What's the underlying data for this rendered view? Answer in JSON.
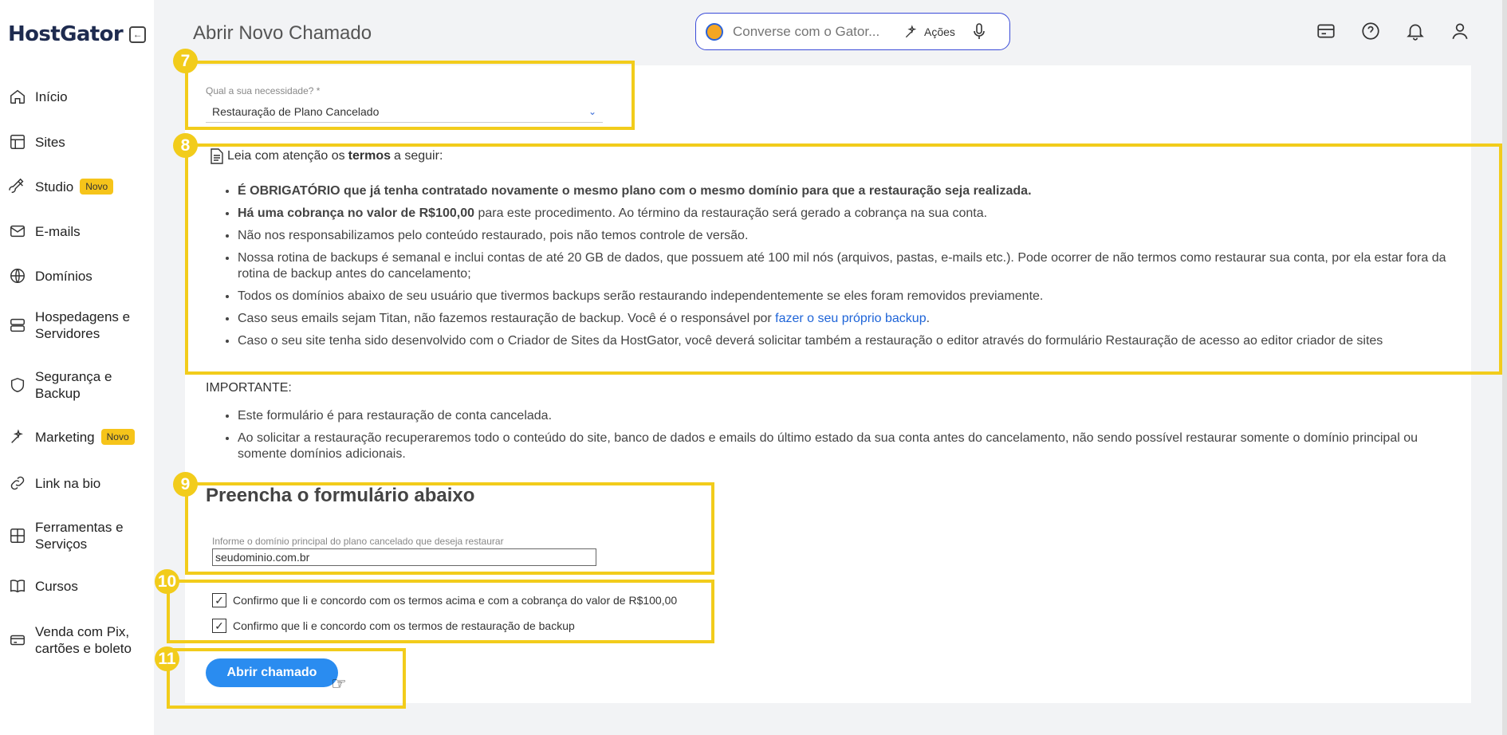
{
  "brand": {
    "logo": "HostGator",
    "collapse_icon": "arrow-left-box-icon"
  },
  "sidebar": {
    "items": [
      {
        "label": "Início",
        "icon": "home-icon"
      },
      {
        "label": "Sites",
        "icon": "layout-icon"
      },
      {
        "label": "Studio",
        "icon": "brush-icon",
        "badge": "Novo"
      },
      {
        "label": "E-mails",
        "icon": "mail-icon"
      },
      {
        "label": "Domínios",
        "icon": "globe-icon"
      },
      {
        "label": "Hospedagens e\nServidores",
        "icon": "server-icon"
      },
      {
        "label": "Segurança e\nBackup",
        "icon": "shield-icon"
      },
      {
        "label": "Marketing",
        "icon": "sparkle-icon",
        "badge": "Novo"
      },
      {
        "label": "Link na bio",
        "icon": "link-icon"
      },
      {
        "label": "Ferramentas e\nServiços",
        "icon": "tools-icon"
      },
      {
        "label": "Cursos",
        "icon": "book-icon"
      },
      {
        "label": "Venda com Pix,\ncartões e boleto",
        "icon": "payment-icon"
      }
    ]
  },
  "header": {
    "title": "Abrir Novo Chamado",
    "chat_placeholder": "Converse com o Gator...",
    "actions_label": "Ações"
  },
  "steps": [
    "7",
    "8",
    "9",
    "10",
    "11"
  ],
  "select": {
    "label": "Qual a sua necessidade? *",
    "value": "Restauração de Plano Cancelado"
  },
  "terms": {
    "intro_pre": "Leia com atenção os",
    "intro_bold": "termos",
    "intro_post": "a seguir:",
    "item1": "É OBRIGATÓRIO que já tenha contratado novamente o mesmo plano com o mesmo domínio para que a restauração seja realizada.",
    "item2_bold": "Há uma cobrança no valor de R$100,00",
    "item2_rest": " para este procedimento. Ao término da restauração será gerado a cobrança na sua conta.",
    "item3": "Não nos responsabilizamos pelo conteúdo restaurado, pois não temos controle de versão.",
    "item4": "Nossa rotina de backups é semanal e inclui contas de até 20 GB de dados, que possuem até 100 mil nós (arquivos, pastas, e-mails etc.). Pode ocorrer de não termos como restaurar sua conta, por ela estar fora da rotina de backup antes do cancelamento;",
    "item5": "Todos os domínios abaixo de seu usuário que tivermos backups serão restaurando independentemente se eles foram removidos previamente.",
    "item6_pre": "Caso seus emails sejam Titan, não fazemos restauração de backup. Você é o responsável por ",
    "item6_link": "fazer o seu próprio backup",
    "item6_post": ".",
    "item7": "Caso o seu site tenha sido desenvolvido com o Criador de Sites da HostGator, você deverá solicitar também a restauração o editor através do formulário Restauração de acesso ao editor criador de sites"
  },
  "important": {
    "title": "IMPORTANTE:",
    "item1": "Este formulário é para restauração de conta cancelada.",
    "item2": "Ao solicitar a restauração recuperaremos todo o conteúdo do site, banco de dados e emails do último estado da sua conta antes do cancelamento, não sendo possível restaurar somente o domínio principal ou somente domínios adicionais."
  },
  "form": {
    "title": "Preencha o formulário abaixo",
    "domain_label": "Informe o domínio principal do plano cancelado que deseja restaurar",
    "domain_value": "seudominio.com.br"
  },
  "checks": {
    "check1": "Confirmo que li e concordo com os termos acima e com a cobrança do valor de R$100,00",
    "check2": "Confirmo que li e concordo com os termos de restauração de backup"
  },
  "submit_label": "Abrir chamado",
  "colors": {
    "highlight": "#f2cc1b",
    "primary": "#2a8cf0",
    "link": "#1e64d8",
    "badge": "#f6c41a"
  }
}
